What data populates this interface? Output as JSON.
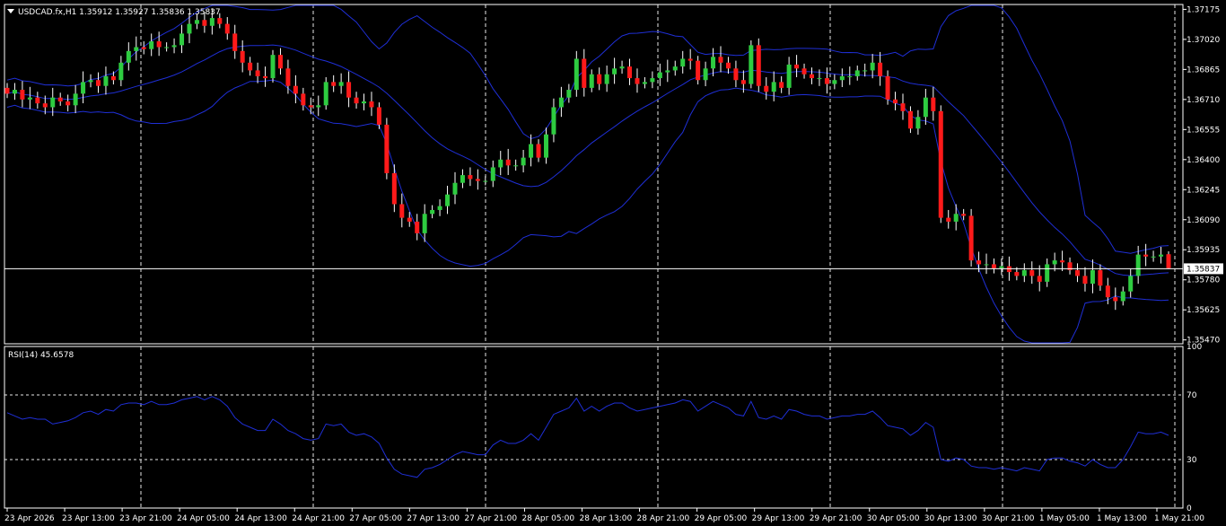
{
  "header": {
    "symbol_info": "USDCAD.fx,H1  1.35912 1.35927 1.35836 1.35837",
    "rsi_info": "RSI(14) 45.6578"
  },
  "colors": {
    "background": "#000000",
    "bull": "#2ecc40",
    "bear": "#ff1a1a",
    "bands": "#1f2fd6",
    "rsi_line": "#1f2fd6",
    "grid": "#ffffff",
    "text": "#ffffff"
  },
  "chart_data": [
    {
      "type": "candlestick",
      "symbol": "USDCAD.fx",
      "timeframe": "H1",
      "ohlc_current": {
        "open": 1.35912,
        "high": 1.35927,
        "low": 1.35836,
        "close": 1.35837
      },
      "current_price_label": "1.35837",
      "current_price": 1.35837,
      "ylim": [
        1.3545,
        1.372
      ],
      "y_ticks": [
        "1.37175",
        "1.37020",
        "1.36865",
        "1.36710",
        "1.36555",
        "1.36400",
        "1.36245",
        "1.36090",
        "1.35935",
        "1.35780",
        "1.35625",
        "1.35470"
      ],
      "x_ticks": [
        "23 Apr 2026",
        "23 Apr 13:00",
        "23 Apr 21:00",
        "24 Apr 05:00",
        "24 Apr 13:00",
        "24 Apr 21:00",
        "27 Apr 05:00",
        "27 Apr 13:00",
        "27 Apr 21:00",
        "28 Apr 05:00",
        "28 Apr 13:00",
        "28 Apr 21:00",
        "29 Apr 05:00",
        "29 Apr 13:00",
        "29 Apr 21:00",
        "30 Apr 05:00",
        "30 Apr 13:00",
        "30 Apr 21:00",
        "1 May 05:00",
        "1 May 13:00",
        "1 May 21:00"
      ],
      "closes": [
        1.3674,
        1.3676,
        1.3671,
        1.3672,
        1.3669,
        1.3667,
        1.3672,
        1.367,
        1.3668,
        1.3674,
        1.368,
        1.3681,
        1.3678,
        1.3683,
        1.3681,
        1.369,
        1.3696,
        1.3698,
        1.3697,
        1.3701,
        1.3698,
        1.3698,
        1.3699,
        1.3705,
        1.371,
        1.3712,
        1.3709,
        1.3713,
        1.371,
        1.3705,
        1.3696,
        1.369,
        1.3686,
        1.3683,
        1.3682,
        1.3694,
        1.3687,
        1.3678,
        1.3674,
        1.3668,
        1.3667,
        1.3668,
        1.368,
        1.3678,
        1.368,
        1.3672,
        1.3669,
        1.367,
        1.3667,
        1.3658,
        1.3633,
        1.3617,
        1.361,
        1.3608,
        1.3602,
        1.3612,
        1.3614,
        1.3616,
        1.3622,
        1.3628,
        1.3632,
        1.363,
        1.3629,
        1.3629,
        1.3636,
        1.364,
        1.3637,
        1.3637,
        1.3641,
        1.3648,
        1.3641,
        1.3653,
        1.3667,
        1.3672,
        1.3676,
        1.3692,
        1.3677,
        1.3684,
        1.3679,
        1.3684,
        1.3687,
        1.3688,
        1.3682,
        1.3679,
        1.368,
        1.3682,
        1.3685,
        1.3686,
        1.3688,
        1.3692,
        1.3691,
        1.3681,
        1.3687,
        1.3693,
        1.369,
        1.3687,
        1.3681,
        1.3679,
        1.3699,
        1.3678,
        1.3675,
        1.368,
        1.3677,
        1.3689,
        1.3687,
        1.3684,
        1.3682,
        1.3682,
        1.3679,
        1.3681,
        1.3683,
        1.3683,
        1.3686,
        1.3686,
        1.369,
        1.3683,
        1.3671,
        1.3669,
        1.3665,
        1.3656,
        1.3662,
        1.3672,
        1.3665,
        1.361,
        1.3608,
        1.3612,
        1.3611,
        1.3588,
        1.3586,
        1.3586,
        1.3584,
        1.3585,
        1.3582,
        1.358,
        1.3583,
        1.358,
        1.3577,
        1.3586,
        1.3588,
        1.3587,
        1.3583,
        1.358,
        1.3576,
        1.3583,
        1.3575,
        1.3569,
        1.3567,
        1.3572,
        1.358,
        1.3591,
        1.359,
        1.359,
        1.3591,
        1.3584
      ]
    },
    {
      "type": "line",
      "name": "RSI(14)",
      "value_label": "45.6578",
      "ylim": [
        0,
        100
      ],
      "y_ticks": [
        "100",
        "70",
        "30",
        "0"
      ],
      "levels": [
        70,
        30
      ],
      "values": [
        59,
        57,
        55,
        56,
        55,
        55,
        52,
        53,
        54,
        56,
        59,
        60,
        58,
        61,
        60,
        64,
        65,
        65,
        64,
        66,
        64,
        64,
        65,
        67,
        68,
        69,
        67,
        69,
        67,
        63,
        56,
        52,
        50,
        48,
        48,
        55,
        52,
        48,
        46,
        43,
        42,
        43,
        52,
        51,
        52,
        47,
        45,
        46,
        44,
        40,
        31,
        24,
        21,
        20,
        19,
        24,
        25,
        27,
        30,
        33,
        35,
        34,
        33,
        33,
        39,
        42,
        40,
        40,
        42,
        46,
        42,
        50,
        58,
        60,
        62,
        68,
        60,
        63,
        60,
        63,
        65,
        65,
        62,
        60,
        61,
        62,
        63,
        64,
        65,
        67,
        66,
        60,
        63,
        66,
        64,
        62,
        58,
        57,
        66,
        56,
        55,
        57,
        55,
        61,
        60,
        58,
        57,
        57,
        55,
        56,
        57,
        57,
        58,
        58,
        60,
        56,
        51,
        50,
        49,
        45,
        48,
        53,
        50,
        30,
        29,
        31,
        30,
        26,
        25,
        25,
        24,
        25,
        24,
        23,
        25,
        24,
        23,
        30,
        31,
        31,
        29,
        28,
        26,
        30,
        27,
        25,
        25,
        30,
        38,
        47,
        46,
        46,
        47,
        45
      ]
    }
  ]
}
